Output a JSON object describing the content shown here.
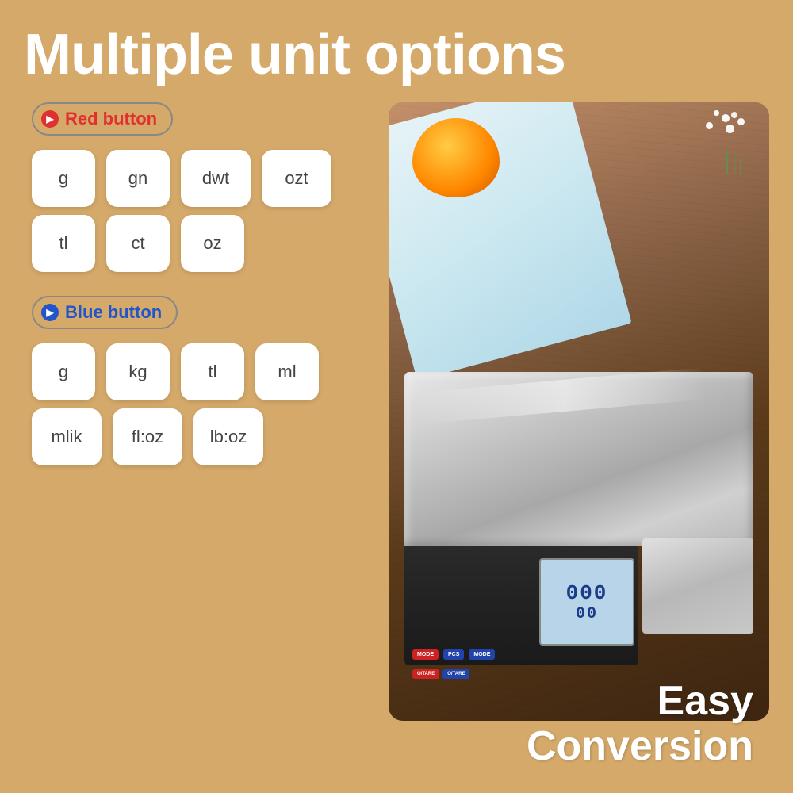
{
  "page": {
    "background_color": "#d4a96a",
    "title": "Multiple unit options",
    "easy_conversion": {
      "line1": "Easy",
      "line2": "Conversion"
    },
    "red_button_section": {
      "label": "Red button",
      "color": "#e03030",
      "units": [
        "g",
        "gn",
        "dwt",
        "ozt",
        "tl",
        "ct",
        "oz"
      ]
    },
    "blue_button_section": {
      "label": "Blue button",
      "color": "#2255cc",
      "units": [
        "g",
        "kg",
        "tl",
        "ml",
        "mlik",
        "fl:oz",
        "lb:oz"
      ]
    }
  }
}
